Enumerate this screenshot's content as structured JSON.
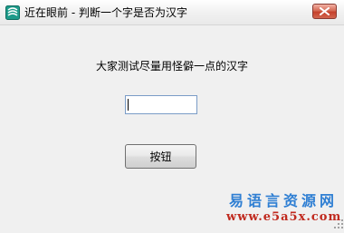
{
  "window": {
    "title": "近在眼前 - 判断一个字是否为汉字"
  },
  "main": {
    "prompt": "大家测试尽量用怪僻一点的汉字",
    "input_value": "",
    "button_label": "按钮"
  },
  "watermark": {
    "site_name": "易语言资源网",
    "site_url": "www.e5a5x.com"
  },
  "colors": {
    "close_button": "#c5412c",
    "watermark_blue": "#2f7fd3",
    "watermark_red": "#c02a1f"
  },
  "icons": {
    "app": "app-icon",
    "close": "close-icon",
    "resize": "resize-grip-icon"
  }
}
